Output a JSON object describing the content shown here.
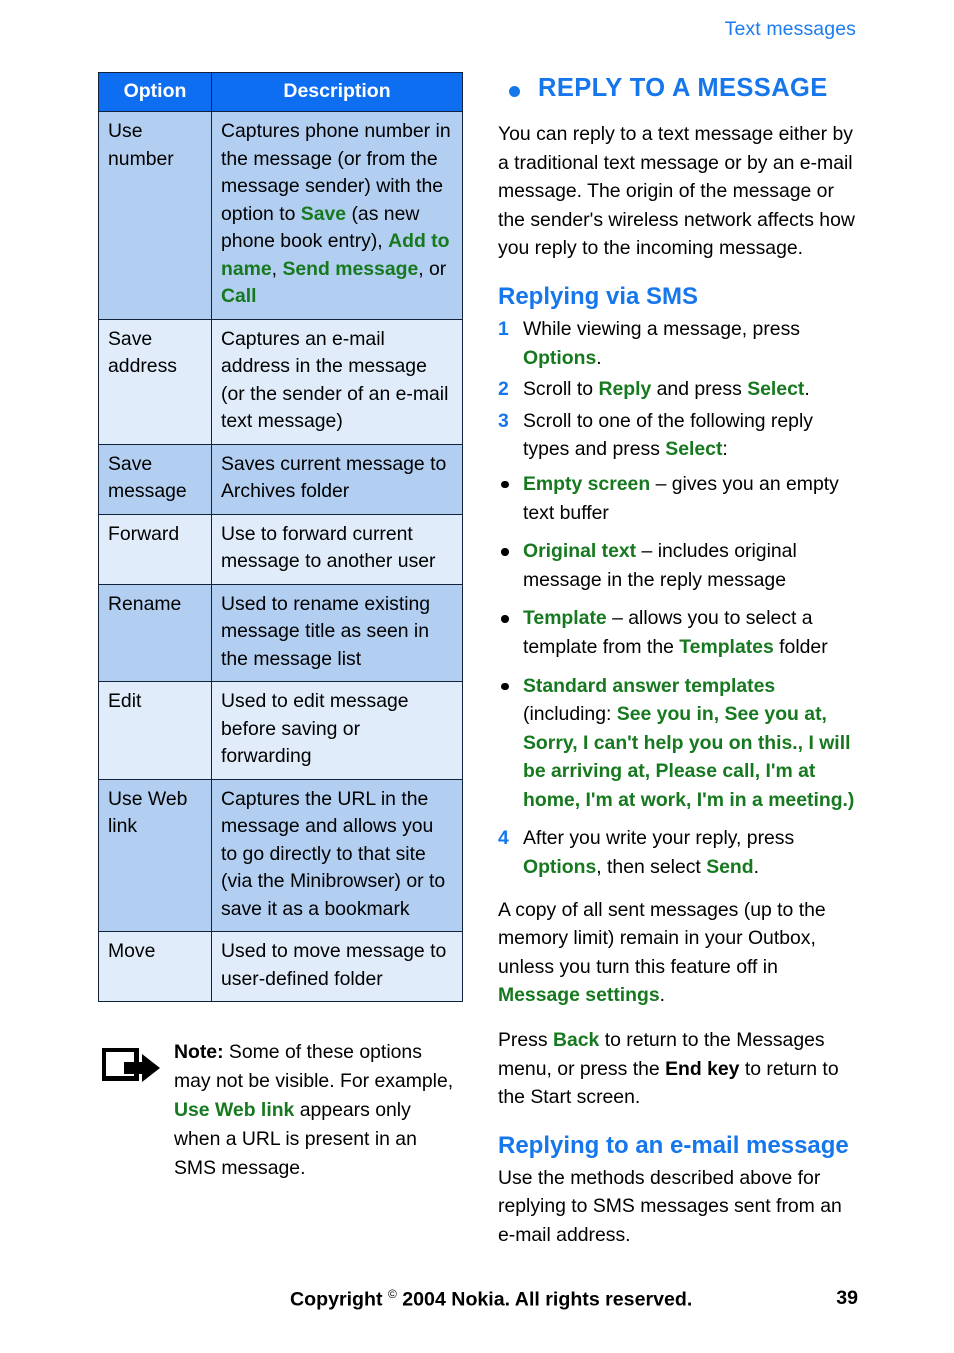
{
  "header": {
    "running_head": "Text messages"
  },
  "colors": {
    "heading_blue": "#1677ec",
    "table_header_blue": "#0d6ef2",
    "row_band_dark": "#b2cef1",
    "row_band_light": "#e0ecfa",
    "ui_term_green": "#17791f",
    "body_black": "#000000"
  },
  "table": {
    "name": "message-options-table",
    "columns": [
      "Option",
      "Description"
    ],
    "rows": [
      {
        "option": "Use number",
        "description_parts": [
          {
            "t": "Captures phone number in the message (or from the message sender) with the option to ",
            "s": "plain"
          },
          {
            "t": "Save",
            "s": "term"
          },
          {
            "t": " (as new phone book entry), ",
            "s": "plain"
          },
          {
            "t": "Add to name",
            "s": "term"
          },
          {
            "t": ", ",
            "s": "plain"
          },
          {
            "t": "Send message",
            "s": "term"
          },
          {
            "t": ", or ",
            "s": "plain"
          },
          {
            "t": "Call",
            "s": "term"
          }
        ]
      },
      {
        "option": "Save address",
        "description_parts": [
          {
            "t": "Captures an e-mail address in the message (or the sender of an e-mail text message)",
            "s": "plain"
          }
        ]
      },
      {
        "option": "Save message",
        "description_parts": [
          {
            "t": "Saves current message to Archives folder",
            "s": "plain"
          }
        ]
      },
      {
        "option": "Forward",
        "description_parts": [
          {
            "t": "Use to forward current message to another user",
            "s": "plain"
          }
        ]
      },
      {
        "option": "Rename",
        "description_parts": [
          {
            "t": "Used to rename existing message title as seen in the message list",
            "s": "plain"
          }
        ]
      },
      {
        "option": "Edit",
        "description_parts": [
          {
            "t": "Used to edit message before saving or forwarding",
            "s": "plain"
          }
        ]
      },
      {
        "option": "Use Web link",
        "description_parts": [
          {
            "t": "Captures the URL in the message and allows you to go directly to that site (via the Minibrowser) or to save it as a bookmark",
            "s": "plain"
          }
        ]
      },
      {
        "option": "Move",
        "description_parts": [
          {
            "t": "Used to move message to user-defined folder",
            "s": "plain"
          }
        ]
      }
    ]
  },
  "note": {
    "icon": "note-arrow-icon",
    "parts": [
      {
        "t": "Note:",
        "s": "bold"
      },
      {
        "t": " Some of these options may not be visible. For example, ",
        "s": "plain"
      },
      {
        "t": "Use Web link",
        "s": "term"
      },
      {
        "t": " appears only when a URL is present in an SMS message.",
        "s": "plain"
      }
    ]
  },
  "main": {
    "h1": "REPLY TO A MESSAGE",
    "intro": "You can reply to a text message either by a traditional text message or by an e-mail message. The origin of the message or the sender's wireless network affects how you reply to the incoming message.",
    "h2_sms": "Replying via SMS",
    "steps_sms": [
      {
        "num": "1",
        "parts": [
          {
            "t": "While viewing a message, press ",
            "s": "plain"
          },
          {
            "t": "Options",
            "s": "term"
          },
          {
            "t": ".",
            "s": "plain"
          }
        ]
      },
      {
        "num": "2",
        "parts": [
          {
            "t": "Scroll to ",
            "s": "plain"
          },
          {
            "t": "Reply",
            "s": "term"
          },
          {
            "t": " and press ",
            "s": "plain"
          },
          {
            "t": "Select",
            "s": "term"
          },
          {
            "t": ".",
            "s": "plain"
          }
        ]
      },
      {
        "num": "3",
        "parts": [
          {
            "t": "Scroll to one of the following reply types and press ",
            "s": "plain"
          },
          {
            "t": "Select",
            "s": "term"
          },
          {
            "t": ":",
            "s": "plain"
          }
        ]
      }
    ],
    "reply_types": [
      {
        "parts": [
          {
            "t": "Empty screen",
            "s": "term"
          },
          {
            "t": " – gives you an empty text buffer",
            "s": "plain"
          }
        ]
      },
      {
        "parts": [
          {
            "t": "Original text",
            "s": "term"
          },
          {
            "t": " – includes original message in the reply message",
            "s": "plain"
          }
        ]
      },
      {
        "parts": [
          {
            "t": "Template",
            "s": "term"
          },
          {
            "t": " – allows you to select a template from the ",
            "s": "plain"
          },
          {
            "t": "Templates",
            "s": "term"
          },
          {
            "t": " folder",
            "s": "plain"
          }
        ]
      },
      {
        "parts": [
          {
            "t": "Standard answer templates",
            "s": "term"
          },
          {
            "t": " (including: ",
            "s": "plain"
          },
          {
            "t": "See you in, See you at, Sorry, I can't help you on this., I will be arriving at, Please call, I'm at home, I'm at work, I'm in a meeting.)",
            "s": "term"
          }
        ]
      }
    ],
    "steps_sms_after": [
      {
        "num": "4",
        "parts": [
          {
            "t": "After you write your reply, press ",
            "s": "plain"
          },
          {
            "t": "Options",
            "s": "term"
          },
          {
            "t": ", then select ",
            "s": "plain"
          },
          {
            "t": "Send",
            "s": "term"
          },
          {
            "t": ".",
            "s": "plain"
          }
        ]
      }
    ],
    "para_copy": [
      {
        "t": "A copy of all sent messages (up to the memory limit) remain in your Outbox, unless you turn this feature off in ",
        "s": "plain"
      },
      {
        "t": "Message settings",
        "s": "term"
      },
      {
        "t": ".",
        "s": "plain"
      }
    ],
    "para_back": [
      {
        "t": "Press ",
        "s": "plain"
      },
      {
        "t": "Back",
        "s": "term"
      },
      {
        "t": " to return to the Messages menu, or press the ",
        "s": "plain"
      },
      {
        "t": "End key",
        "s": "bold"
      },
      {
        "t": " to return to the Start screen.",
        "s": "plain"
      }
    ],
    "h2_email": "Replying to an e-mail message",
    "email_body": "Use the methods described above for replying to SMS messages sent from an e-mail address."
  },
  "footer": {
    "copyright_before": "Copyright ",
    "copyright_mark": "©",
    "copyright_after": " 2004 Nokia. All rights reserved.",
    "page_number": "39"
  }
}
